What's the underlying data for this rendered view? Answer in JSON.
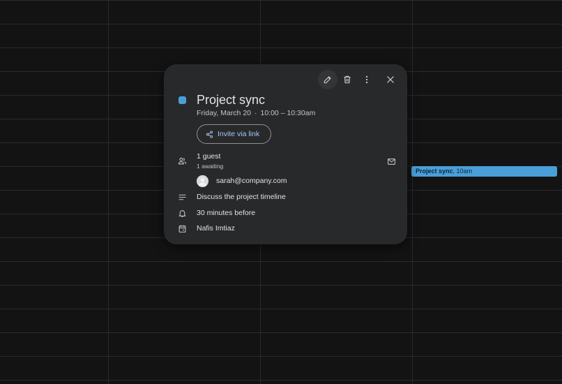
{
  "calendar": {
    "event_chip": {
      "title": "Project sync",
      "time": "10am",
      "color": "#4b9fd8"
    }
  },
  "popover": {
    "toolbar": {
      "edit_icon": "pencil-icon",
      "delete_icon": "trash-icon",
      "more_icon": "more-vert-icon",
      "close_icon": "close-icon"
    },
    "event": {
      "title": "Project sync",
      "date": "Friday, March 20",
      "separator": "·",
      "time_range": "10:00 – 10:30am",
      "color": "#4b9fd8"
    },
    "invite_button": {
      "label": "Invite via link",
      "icon": "share-icon"
    },
    "guests": {
      "summary": "1 guest",
      "status": "1 awaiting",
      "icon": "people-icon",
      "email_icon": "mail-icon",
      "list": [
        {
          "email": "sarah@company.com"
        }
      ]
    },
    "description": {
      "text": "Discuss the project timeline",
      "icon": "notes-icon"
    },
    "reminder": {
      "text": "30 minutes before",
      "icon": "bell-icon"
    },
    "organizer": {
      "text": "Nafis Imtiaz",
      "icon": "calendar-icon"
    }
  },
  "colors": {
    "background": "#131314",
    "card": "#28292a",
    "accent_link": "#a8c7fa"
  }
}
